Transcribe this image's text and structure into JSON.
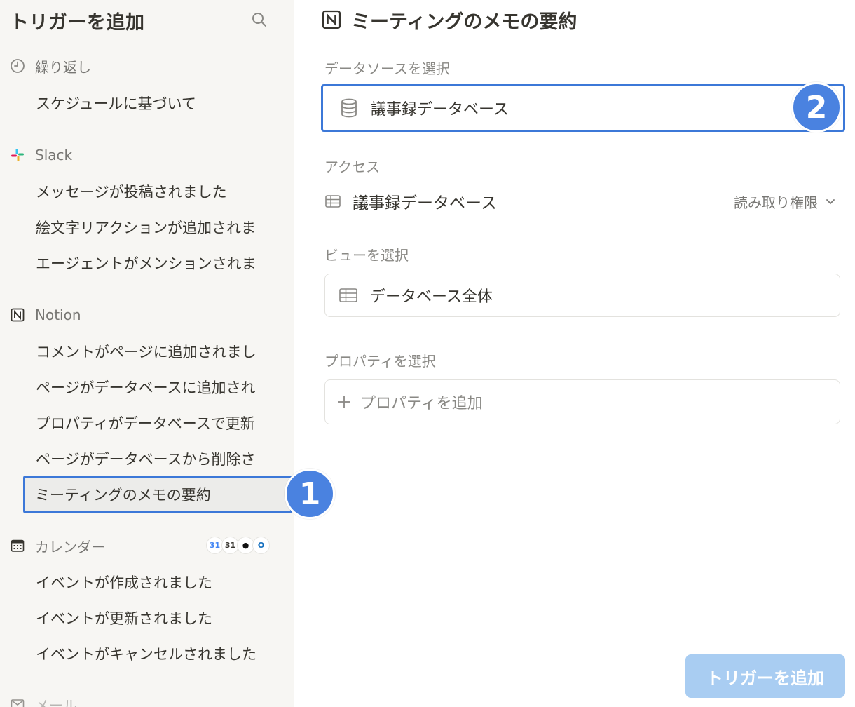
{
  "sidebar": {
    "title": "トリガーを追加",
    "sections": {
      "recurring": {
        "label": "繰り返し",
        "items": [
          "スケジュールに基づいて"
        ]
      },
      "slack": {
        "label": "Slack",
        "items": [
          "メッセージが投稿されました",
          "絵文字リアクションが追加されま",
          "エージェントがメンションされま"
        ]
      },
      "notion": {
        "label": "Notion",
        "items": [
          "コメントがページに追加されまし",
          "ページがデータベースに追加され",
          "プロパティがデータベースで更新",
          "ページがデータベースから削除さ",
          "ミーティングのメモの要約"
        ]
      },
      "calendar": {
        "label": "カレンダー",
        "items": [
          "イベントが作成されました",
          "イベントが更新されました",
          "イベントがキャンセルされました"
        ]
      },
      "mail": {
        "label": "メール"
      }
    }
  },
  "badges": {
    "one": "1",
    "two": "2"
  },
  "main": {
    "title": "ミーティングのメモの要約",
    "datasource_label": "データソースを選択",
    "datasource_value": "議事録データベース",
    "access_label": "アクセス",
    "access_db": "議事録データベース",
    "access_permission": "読み取り権限",
    "view_label": "ビューを選択",
    "view_value": "データベース全体",
    "property_label": "プロパティを選択",
    "property_add": "プロパティを追加",
    "submit_button": "トリガーを追加"
  },
  "colors": {
    "accent_blue": "#3c78d8",
    "badge_blue": "#4a82e0",
    "button_disabled": "#a9cdf2"
  }
}
